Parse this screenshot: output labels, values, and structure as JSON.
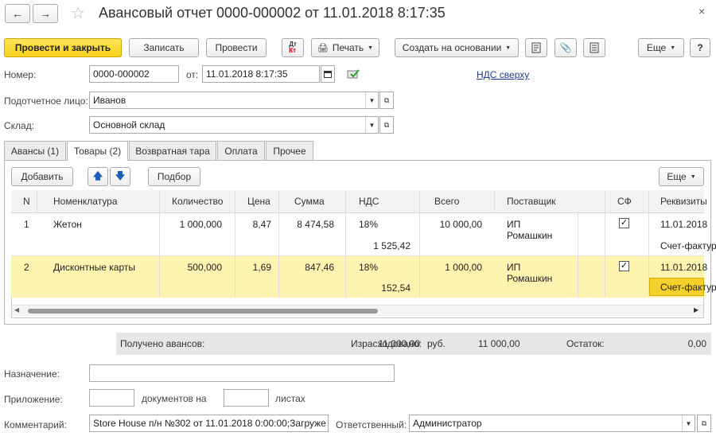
{
  "window": {
    "title": "Авансовый отчет 0000-000002 от 11.01.2018 8:17:35",
    "back_icon": "arrow-left",
    "forward_icon": "arrow-right",
    "favorite_icon": "star",
    "close_glyph": "×"
  },
  "toolbar": {
    "post_close": "Провести и закрыть",
    "save": "Записать",
    "post": "Провести",
    "print": "Печать",
    "create_based": "Создать на основании",
    "more": "Еще",
    "help": "?"
  },
  "header": {
    "number_label": "Номер:",
    "number_value": "0000-000002",
    "date_label": "от:",
    "date_value": "11.01.2018  8:17:35",
    "vat_link": "НДС сверху",
    "person_label": "Подотчетное лицо:",
    "person_value": "Иванов",
    "warehouse_label": "Склад:",
    "warehouse_value": "Основной склад"
  },
  "tabs": [
    "Авансы (1)",
    "Товары (2)",
    "Возвратная тара",
    "Оплата",
    "Прочее"
  ],
  "goods": {
    "add": "Добавить",
    "pick": "Подбор",
    "more": "Еще",
    "columns": [
      "N",
      "Номенклатура",
      "Количество",
      "Цена",
      "Сумма",
      "НДС",
      "Всего",
      "Поставщик",
      "СФ",
      "Реквизиты"
    ],
    "rows": [
      {
        "n": "1",
        "name": "Жетон",
        "qty": "1 000,000",
        "price": "8,47",
        "sum": "8 474,58",
        "vat_rate": "18%",
        "vat_sum": "1 525,42",
        "total": "10 000,00",
        "supplier1": "ИП",
        "supplier2": "Ромашкин",
        "sf": true,
        "req1": "11.01.2018",
        "req2": "Счет-фактура"
      },
      {
        "n": "2",
        "name": "Дисконтные карты",
        "qty": "500,000",
        "price": "1,69",
        "sum": "847,46",
        "vat_rate": "18%",
        "vat_sum": "152,54",
        "total": "1 000,00",
        "supplier1": "ИП",
        "supplier2": "Ромашкин",
        "sf": true,
        "req1": "11.01.2018",
        "req2": "Счет-фактура"
      }
    ],
    "selected_color": "#fff3b0"
  },
  "totals": {
    "received_label": "Получено авансов:",
    "received_value": "11 000,00",
    "currency": "руб.",
    "spent_label": "Израсходовано:",
    "spent_value": "11 000,00",
    "balance_label": "Остаток:",
    "balance_value": "0,00"
  },
  "footer": {
    "purpose_label": "Назначение:",
    "purpose_value": "",
    "attachment_label": "Приложение:",
    "docs_label": "документов на",
    "sheets_label": "листах",
    "comment_label": "Комментарий:",
    "comment_value": "Store House п/н №302 от 11.01.2018 0:00:00;Загруже",
    "responsible_label": "Ответственный:",
    "responsible_value": "Администратор"
  }
}
